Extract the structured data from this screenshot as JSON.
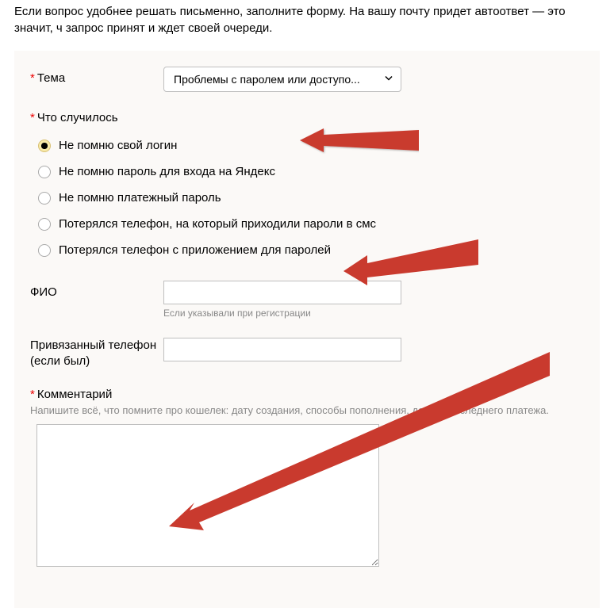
{
  "intro": "Если вопрос удобнее решать письменно, заполните форму. На вашу почту придет автоответ — это значит, ч запрос принят и ждет своей очереди.",
  "topic": {
    "label": "Тема",
    "value": "Проблемы с паролем или доступо..."
  },
  "what_happened": {
    "label": "Что случилось",
    "options": [
      "Не помню свой логин",
      "Не помню пароль для входа на Яндекс",
      "Не помню платежный пароль",
      "Потерялся телефон, на который приходили пароли в смс",
      "Потерялся телефон с приложением для паролей"
    ],
    "selected_index": 0
  },
  "fio": {
    "label": "ФИО",
    "hint": "Если указывали при регистрации",
    "value": ""
  },
  "phone": {
    "label": "Привязанный телефон (если был)",
    "value": ""
  },
  "comment": {
    "label": "Комментарий",
    "hint": "Напишите всё, что помните про кошелек: дату создания, способы пополнения, детали последнего платежа.",
    "value": ""
  }
}
